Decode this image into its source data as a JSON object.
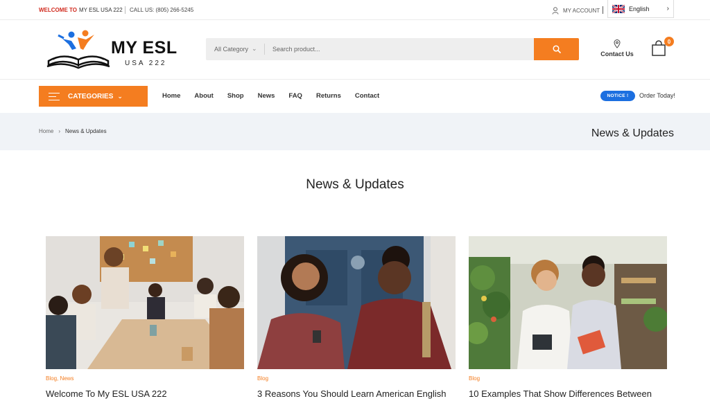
{
  "topbar": {
    "welcome": "WELCOME TO",
    "site": "MY ESL USA 222",
    "call": "CALL US: (805) 266-5245",
    "account": "MY ACCOUNT",
    "language": "English"
  },
  "header": {
    "logo_title": "MY ESL",
    "logo_sub": "USA 222",
    "search_category": "All Category",
    "search_placeholder": "Search product...",
    "contact": "Contact Us",
    "cart_count": "0"
  },
  "nav": {
    "categories": "CATEGORIES",
    "links": [
      "Home",
      "About",
      "Shop",
      "News",
      "FAQ",
      "Returns",
      "Contact"
    ],
    "notice": "NOTICE !",
    "order": "Order Today!"
  },
  "breadcrumb": {
    "home": "Home",
    "current": "News & Updates",
    "title": "News & Updates"
  },
  "section": {
    "title": "News & Updates"
  },
  "posts": [
    {
      "categories": "Blog, News",
      "title": "Welcome To My ESL USA 222"
    },
    {
      "categories": "Blog",
      "title": "3 Reasons You Should Learn American English"
    },
    {
      "categories": "Blog",
      "title": "10 Examples That Show Differences Between"
    }
  ],
  "colors": {
    "accent": "#f47d20",
    "notice": "#1c6fe0",
    "welcome": "#d12a1e",
    "band": "#f0f3f7"
  }
}
